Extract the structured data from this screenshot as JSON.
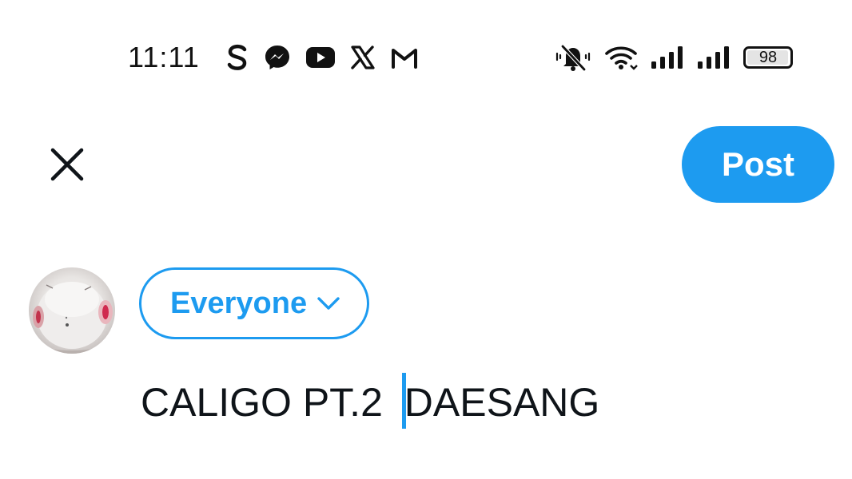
{
  "status_bar": {
    "time": "11:11",
    "left_icons": [
      "skype-icon",
      "messenger-icon",
      "youtube-icon",
      "x-icon",
      "gmail-icon"
    ],
    "right_icons": [
      "mute-icon",
      "wifi-icon",
      "signal-icon",
      "signal-icon"
    ],
    "battery_text": "98",
    "battery_level": 98
  },
  "header": {
    "close_icon": "close-icon",
    "post_label": "Post"
  },
  "composer": {
    "audience_label": "Everyone",
    "text_before_cursor": "CALIGO PT.2 ",
    "text_after_cursor": "DAESANG"
  },
  "colors": {
    "accent": "#1d9bf0",
    "text": "#0f1419",
    "background": "#ffffff"
  }
}
